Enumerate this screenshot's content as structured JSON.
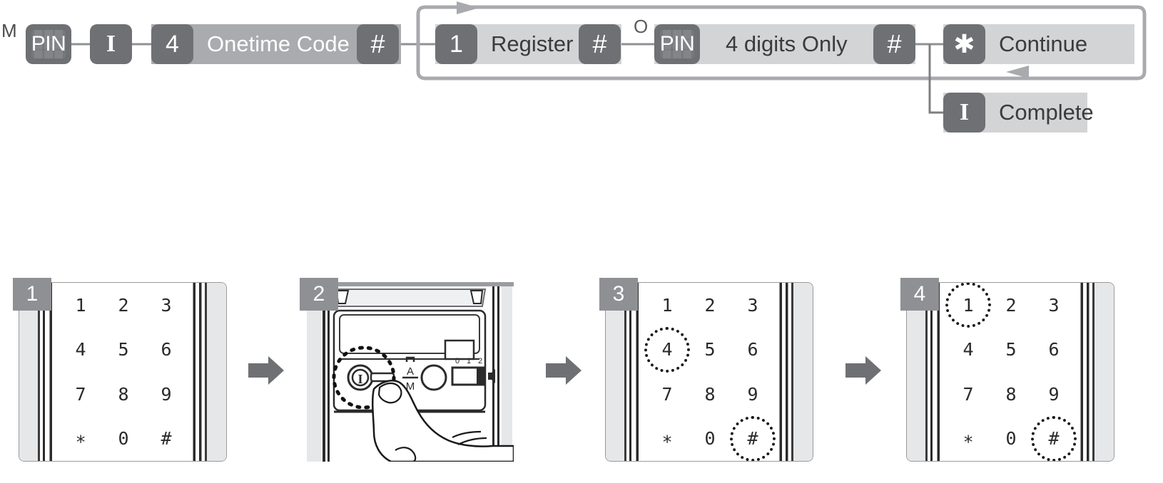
{
  "flow": {
    "mode_label": "M",
    "o_mark": "O",
    "segments": [
      {
        "key": "PIN",
        "icon": "pin-key-icon",
        "label": ""
      },
      {
        "key": "I",
        "icon": "i-key-icon",
        "label": ""
      },
      {
        "key": "4",
        "icon": "digit-4-key-icon",
        "label": "Onetime Code"
      },
      {
        "key": "#",
        "icon": "hash-key-icon",
        "label": ""
      },
      {
        "key": "1",
        "icon": "digit-1-key-icon",
        "label": "Register"
      },
      {
        "key": "#",
        "icon": "hash-key-icon",
        "label": ""
      },
      {
        "key": "PIN",
        "icon": "pin-key-icon",
        "label": "4 digits Only"
      },
      {
        "key": "#",
        "icon": "hash-key-icon",
        "label": ""
      },
      {
        "key": "✱",
        "icon": "star-key-icon",
        "label": "Continue"
      },
      {
        "key": "I",
        "icon": "i-key-icon",
        "label": "Complete"
      }
    ],
    "keys": {
      "pin": "PIN",
      "i": "I",
      "four": "4",
      "one": "1",
      "hash": "#",
      "star": "✱"
    },
    "labels": {
      "onetime_code": "Onetime Code",
      "register": "Register",
      "four_digits_only": "4 digits Only",
      "continue": "Continue",
      "complete": "Complete"
    }
  },
  "steps": [
    {
      "number": "1",
      "kind": "keypad",
      "keys": [
        "1",
        "2",
        "3",
        "4",
        "5",
        "6",
        "7",
        "8",
        "9",
        "∗",
        "0",
        "#"
      ],
      "highlighted": []
    },
    {
      "number": "2",
      "kind": "device",
      "controls": {
        "power_button": "I",
        "mode_switch_top": "A",
        "mode_switch_bottom": "M",
        "volume_ticks": [
          "0",
          "1",
          "2"
        ],
        "speaker_icon": "speaker-icon"
      }
    },
    {
      "number": "3",
      "kind": "keypad",
      "keys": [
        "1",
        "2",
        "3",
        "4",
        "5",
        "6",
        "7",
        "8",
        "9",
        "∗",
        "0",
        "#"
      ],
      "highlighted": [
        3,
        11
      ]
    },
    {
      "number": "4",
      "kind": "keypad",
      "keys": [
        "1",
        "2",
        "3",
        "4",
        "5",
        "6",
        "7",
        "8",
        "9",
        "∗",
        "0",
        "#"
      ],
      "highlighted": [
        0,
        11
      ]
    }
  ],
  "colors": {
    "key_fill": "#6e7074",
    "bar_dark": "#a9abae",
    "bar_light": "#d3d4d6",
    "badge": "#8e9094",
    "line": "#9a9c9f",
    "arrow": "#6e7074",
    "text_dark": "#3b3b3b"
  }
}
